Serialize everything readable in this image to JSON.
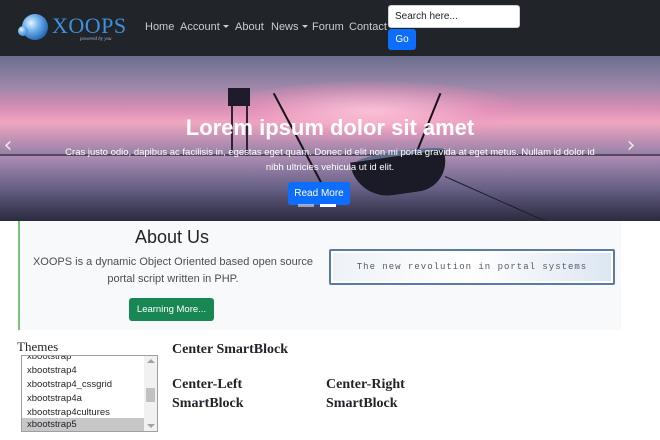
{
  "logo": {
    "name": "XOOPS",
    "tagline": "powered by you"
  },
  "nav": {
    "items": [
      {
        "label": "Home"
      },
      {
        "label": "Account",
        "dropdown": true
      },
      {
        "label": "About"
      },
      {
        "label": "News",
        "dropdown": true
      },
      {
        "label": "Forum"
      },
      {
        "label": "Contact"
      }
    ]
  },
  "search": {
    "placeholder": "Search here...",
    "button_label": "Go"
  },
  "carousel": {
    "title": "Lorem ipsum dolor sit amet",
    "text": "Cras justo odio, dapibus ac facilisis in, egestas eget quam. Donec id elit non mi porta gravida at eget metus. Nullam id dolor id nibh ultricies vehicula ut id elit.",
    "button_label": "Read More",
    "indicator_count": 2,
    "active_index": 1,
    "prev_icon": "‹",
    "next_icon": "›"
  },
  "about": {
    "title": "About Us",
    "text": "XOOPS is a dynamic Object Oriented based open source portal script written in PHP.",
    "button_label": "Learning More...",
    "banner_text": "The new revolution in portal systems"
  },
  "themes": {
    "title": "Themes",
    "options": [
      "xbootstrap",
      "xbootstrap4",
      "xbootstrap4_cssgrid",
      "xbootstrap4a",
      "xbootstrap4cultures",
      "xbootstrap5"
    ],
    "selected": "xbootstrap5"
  },
  "blocks": {
    "center": "Center SmartBlock",
    "center_left": [
      "Center-Left",
      "SmartBlock"
    ],
    "center_right": [
      "Center-Right",
      "SmartBlock"
    ]
  },
  "colors": {
    "navbar": "#212529",
    "primary": "#0d6efd",
    "success": "#198754",
    "accent_border": "#7cc576"
  }
}
